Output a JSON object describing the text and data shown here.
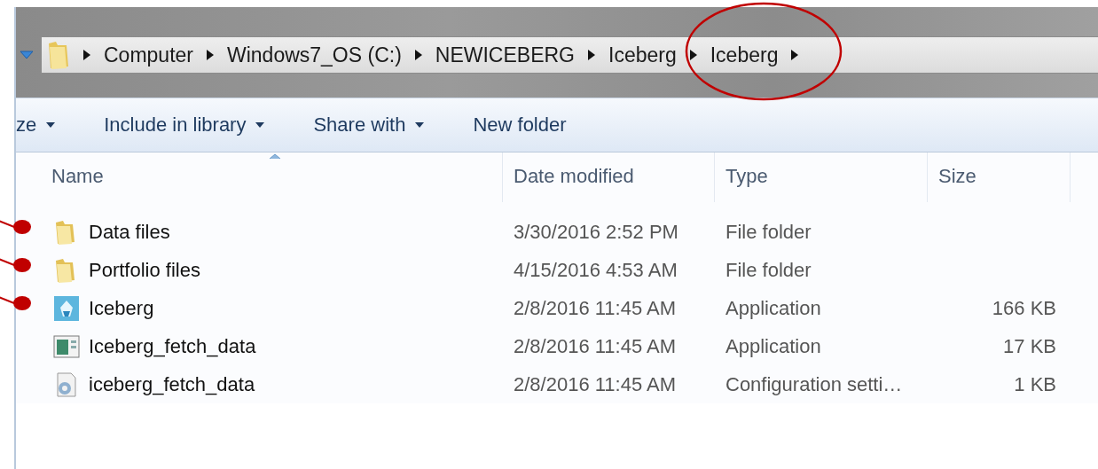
{
  "address_bar": {
    "crumbs": [
      {
        "label": "Computer",
        "circled": false
      },
      {
        "label": "Windows7_OS (C:)",
        "circled": false
      },
      {
        "label": "NEWICEBERG",
        "circled": false
      },
      {
        "label": "Iceberg",
        "circled": false
      },
      {
        "label": "Iceberg",
        "circled": true
      }
    ]
  },
  "toolbar": [
    {
      "label": "ze",
      "menu": true
    },
    {
      "label": "Include in library",
      "menu": true
    },
    {
      "label": "Share with",
      "menu": true
    },
    {
      "label": "New folder",
      "menu": false
    }
  ],
  "table": {
    "columns": [
      {
        "label": "Name",
        "sorted": true
      },
      {
        "label": "Date modified",
        "sorted": false
      },
      {
        "label": "Type",
        "sorted": false
      },
      {
        "label": "Size",
        "sorted": false
      }
    ],
    "rows": [
      {
        "kind": "folder",
        "marked": true,
        "cells": [
          "Data files",
          "3/30/2016 2:52 PM",
          "File folder",
          ""
        ]
      },
      {
        "kind": "folder",
        "marked": true,
        "cells": [
          "Portfolio files",
          "4/15/2016 4:53 AM",
          "File folder",
          ""
        ]
      },
      {
        "kind": "app",
        "marked": true,
        "cells": [
          "Iceberg",
          "2/8/2016 11:45 AM",
          "Application",
          "166 KB"
        ]
      },
      {
        "kind": "window-app",
        "marked": false,
        "cells": [
          "Iceberg_fetch_data",
          "2/8/2016 11:45 AM",
          "Application",
          "17 KB"
        ]
      },
      {
        "kind": "config",
        "marked": false,
        "cells": [
          "iceberg_fetch_data",
          "2/8/2016 11:45 AM",
          "Configuration setti…",
          "1 KB"
        ]
      }
    ]
  }
}
